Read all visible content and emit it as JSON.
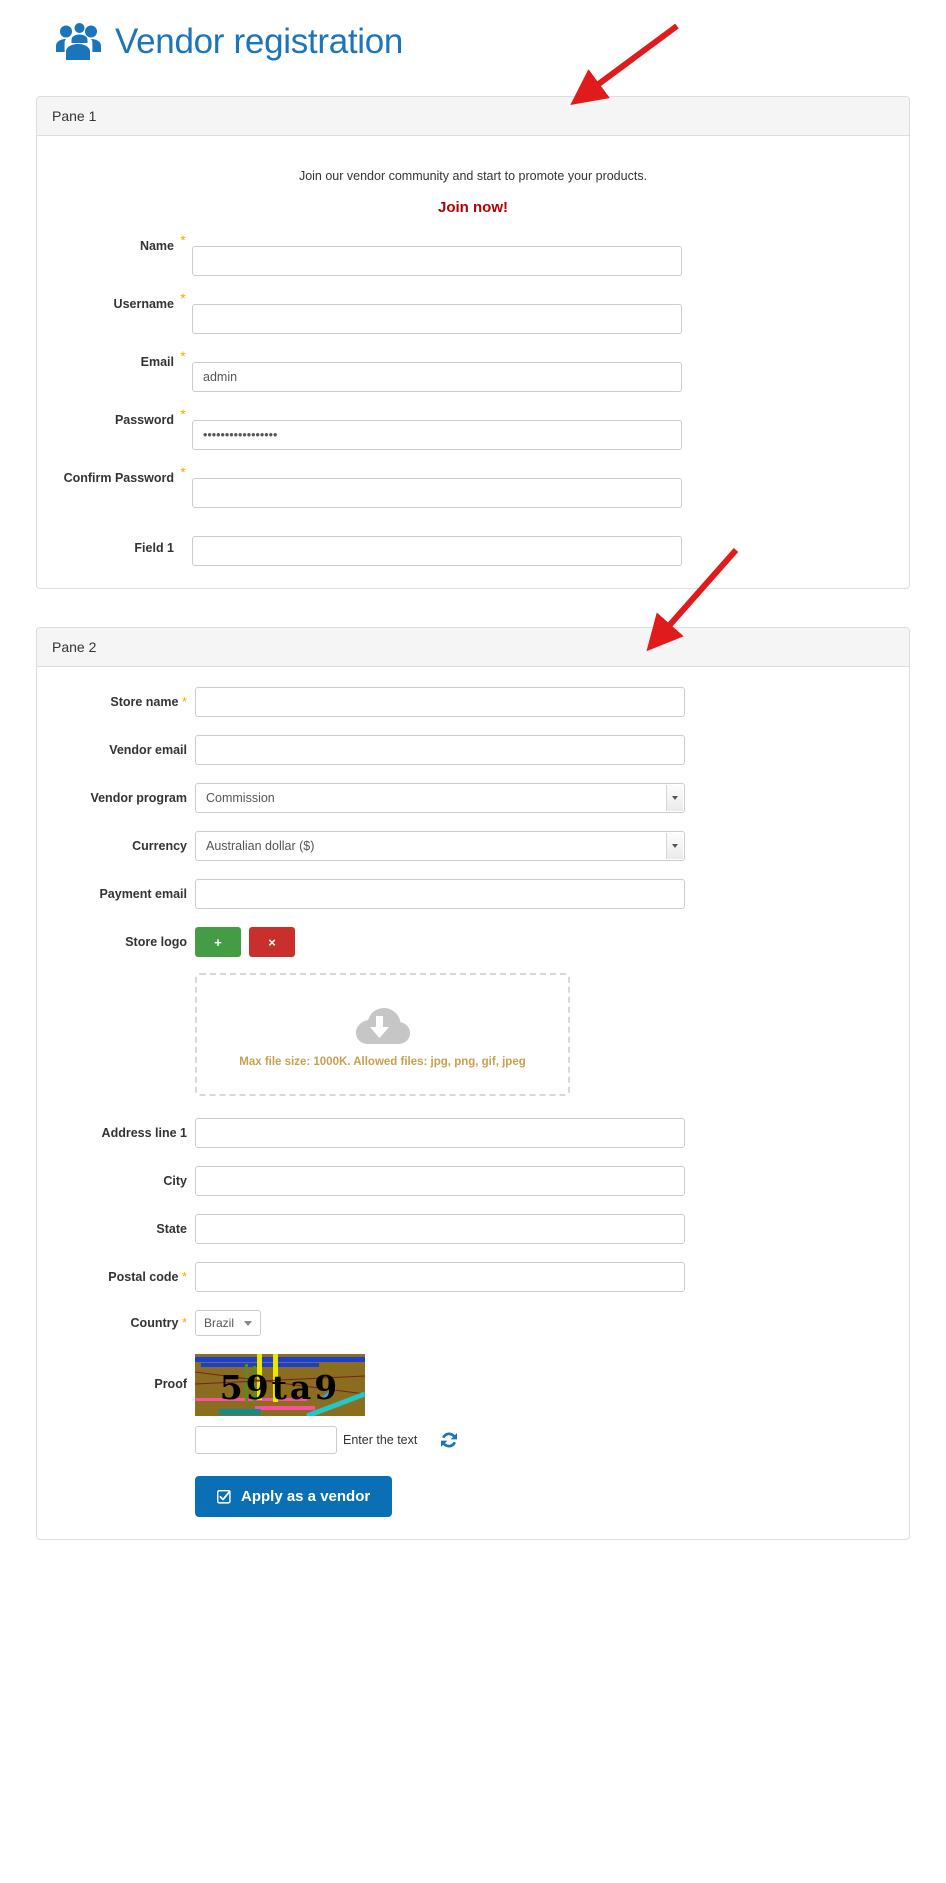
{
  "header": {
    "title": "Vendor registration",
    "icon": "people-group-icon"
  },
  "pane1": {
    "heading": "Pane 1",
    "intro": "Join our vendor community and start to promote your products.",
    "call_to_action": "Join now!",
    "fields": [
      {
        "label": "Name",
        "required": true,
        "value": "",
        "placeholder": ""
      },
      {
        "label": "Username",
        "required": true,
        "value": "",
        "placeholder": ""
      },
      {
        "label": "Email",
        "required": true,
        "value": "admin",
        "placeholder": ""
      },
      {
        "label": "Password",
        "required": true,
        "value": "•••••••••••••••••",
        "placeholder": ""
      },
      {
        "label": "Confirm Password",
        "required": true,
        "value": "",
        "placeholder": ""
      },
      {
        "label": "Field 1",
        "required": false,
        "value": "",
        "placeholder": ""
      }
    ]
  },
  "pane2": {
    "heading": "Pane 2",
    "store_name": {
      "label": "Store name",
      "required": true,
      "value": ""
    },
    "vendor_email": {
      "label": "Vendor email",
      "required": false,
      "value": ""
    },
    "vendor_program": {
      "label": "Vendor program",
      "required": false,
      "value": "Commission"
    },
    "currency": {
      "label": "Currency",
      "required": false,
      "value": "Australian dollar ($)"
    },
    "payment_email": {
      "label": "Payment email",
      "required": false,
      "value": ""
    },
    "store_logo": {
      "label": "Store logo",
      "add_label": "+",
      "delete_label": "×",
      "dropzone_text": "Max file size: 1000K. Allowed files: jpg, png, gif, jpeg",
      "dropzone_icon": "cloud-download-icon"
    },
    "address_line_1": {
      "label": "Address line 1",
      "required": false,
      "value": ""
    },
    "city": {
      "label": "City",
      "required": false,
      "value": ""
    },
    "state": {
      "label": "State",
      "required": false,
      "value": ""
    },
    "postal_code": {
      "label": "Postal code",
      "required": true,
      "value": ""
    },
    "country": {
      "label": "Country",
      "required": true,
      "value": "Brazil"
    },
    "proof": {
      "label": "Proof",
      "captcha_text": "59ta9",
      "input_value": "",
      "hint": "Enter the text",
      "refresh_icon": "refresh-icon"
    },
    "submit": {
      "label": "Apply as a vendor",
      "icon": "check-square-icon"
    }
  },
  "colors": {
    "brand_blue": "#1a75bb",
    "submit_blue": "#0a6fb5",
    "required_star": "#f0ad00",
    "join_red": "#b50000",
    "dropzone_text": "#c8a050",
    "add_green": "#449d44",
    "delete_red": "#c9302c",
    "annotation_red": "#e01b1b"
  },
  "annotations": [
    {
      "name": "arrow-to-pane-1-header"
    },
    {
      "name": "arrow-to-pane-2-header"
    }
  ]
}
